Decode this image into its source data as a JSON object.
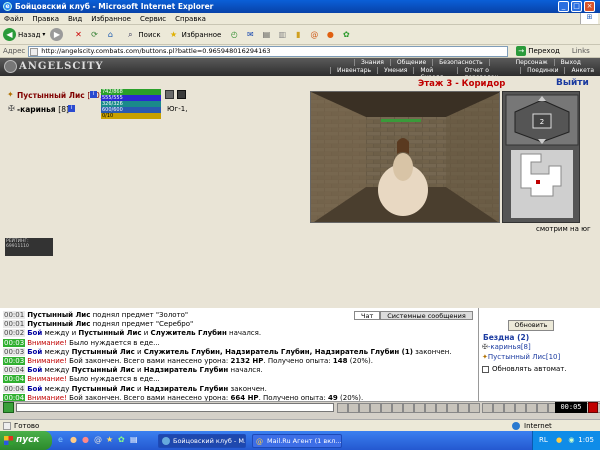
{
  "window": {
    "title": "Бойцовский клуб - Microsoft Internet Explorer"
  },
  "menu": [
    "Файл",
    "Правка",
    "Вид",
    "Избранное",
    "Сервис",
    "Справка"
  ],
  "toolbar": {
    "back": "Назад",
    "search": "Поиск",
    "favorites": "Избранное"
  },
  "address": {
    "label": "Адрес",
    "url": "http://angelscity.combats.com/buttons.pl?battle=0.965948016294163",
    "go": "Переход",
    "links": "Links"
  },
  "game": {
    "logo": "ANGELSCITY",
    "nav_top": [
      "Знания",
      "Общение",
      "Безопасность",
      "Персонаж",
      "Выход"
    ],
    "nav_bottom": [
      "Инвентарь",
      "Умения",
      "Мой Скролл",
      "Отчет о переводах",
      "Поединки",
      "Анкета"
    ],
    "players": [
      {
        "name": "Пустынный Лис",
        "level": "[10]",
        "hp": "742/868",
        "mana": "555/555",
        "stat3": "326/326",
        "stat4": "600/600",
        "stat5": "0/10",
        "hp_frac": 0.85
      },
      {
        "name": "-каринья",
        "level": "[8]"
      }
    ],
    "direction": "Юг-1,",
    "location": {
      "floor": "Этаж 3 - Коридор",
      "exit": "Выйти",
      "facing": "смотрим на юг"
    },
    "counter_small": "РЕЙТИНГ: 69911110"
  },
  "chat": {
    "tabs": [
      "Чат",
      "Системные сообщения"
    ],
    "lines": [
      {
        "time": "00:01",
        "parts": [
          {
            "c": "blk",
            "t": "Пустынный Лис"
          },
          {
            "c": "",
            "t": " поднял предмет \"Золото\""
          }
        ]
      },
      {
        "time": "00:01",
        "parts": [
          {
            "c": "blk",
            "t": "Пустынный Лис"
          },
          {
            "c": "",
            "t": " поднял предмет \"Серебро\""
          }
        ]
      },
      {
        "time": "00:02",
        "parts": [
          {
            "c": "blue",
            "t": "Бой"
          },
          {
            "c": "",
            "t": " между и "
          },
          {
            "c": "blk",
            "t": "Пустынный Лис"
          },
          {
            "c": "",
            "t": " и "
          },
          {
            "c": "blk",
            "t": "Служитель Глубин"
          },
          {
            "c": "",
            "t": " начался."
          }
        ]
      },
      {
        "time": "00:03",
        "green": true,
        "parts": [
          {
            "c": "red",
            "t": "Внимание!"
          },
          {
            "c": "",
            "t": " Было нуждается в еде..."
          }
        ]
      },
      {
        "time": "00:03",
        "parts": [
          {
            "c": "blue",
            "t": "Бой"
          },
          {
            "c": "",
            "t": " между "
          },
          {
            "c": "blk",
            "t": "Пустынный Лис"
          },
          {
            "c": "",
            "t": " и "
          },
          {
            "c": "blk",
            "t": "Служитель Глубин, Надзиратель Глубин, Надзиратель Глубин (1)"
          },
          {
            "c": "",
            "t": " закончен."
          }
        ]
      },
      {
        "time": "00:03",
        "green": true,
        "parts": [
          {
            "c": "red",
            "t": "Внимание!"
          },
          {
            "c": "",
            "t": " Бой закончен. Всего вами нанесено урона: "
          },
          {
            "c": "blk",
            "t": "2132 HP"
          },
          {
            "c": "",
            "t": ". Получено опыта: "
          },
          {
            "c": "blk",
            "t": "148"
          },
          {
            "c": "",
            "t": " (20%)."
          }
        ]
      },
      {
        "time": "00:04",
        "parts": [
          {
            "c": "blue",
            "t": "Бой"
          },
          {
            "c": "",
            "t": " между "
          },
          {
            "c": "blk",
            "t": "Пустынный Лис"
          },
          {
            "c": "",
            "t": " и "
          },
          {
            "c": "blk",
            "t": "Надзиратель Глубин"
          },
          {
            "c": "",
            "t": " начался."
          }
        ]
      },
      {
        "time": "00:04",
        "green": true,
        "parts": [
          {
            "c": "red",
            "t": "Внимание!"
          },
          {
            "c": "",
            "t": " Было нуждается в еде..."
          }
        ]
      },
      {
        "time": "00:04",
        "parts": [
          {
            "c": "blue",
            "t": "Бой"
          },
          {
            "c": "",
            "t": " между "
          },
          {
            "c": "blk",
            "t": "Пустынный Лис"
          },
          {
            "c": "",
            "t": " и "
          },
          {
            "c": "blk",
            "t": "Надзиратель Глубин"
          },
          {
            "c": "",
            "t": " закончен."
          }
        ]
      },
      {
        "time": "00:04",
        "green": true,
        "parts": [
          {
            "c": "red",
            "t": "Внимание!"
          },
          {
            "c": "",
            "t": " Бой закончен. Всего вами нанесено урона: "
          },
          {
            "c": "blk",
            "t": "664 HP"
          },
          {
            "c": "",
            "t": ". Получено опыта: "
          },
          {
            "c": "blk",
            "t": "49"
          },
          {
            "c": "",
            "t": " (20%)."
          }
        ]
      }
    ]
  },
  "room": {
    "refresh": "Обновить",
    "title": "Бездна (2)",
    "users": [
      {
        "name": "-каринья",
        "level": "[8]"
      },
      {
        "name": "Пустынный Лис",
        "level": "[10]"
      }
    ],
    "auto_refresh": "Обновлять автомат."
  },
  "clock": "00:05",
  "status": {
    "ready": "Готово",
    "zone": "Internet"
  },
  "taskbar": {
    "start": "пуск",
    "tasks": [
      "Бойцовский клуб - М...",
      "Mail.Ru Агент (1 вкл..."
    ],
    "lang": "RL",
    "time": "1:05"
  },
  "colors": {
    "hp": "#2aa02a",
    "mana": "#2a2ad0",
    "accent_red": "#c00000",
    "xp_blue": "#1a4cc0"
  }
}
